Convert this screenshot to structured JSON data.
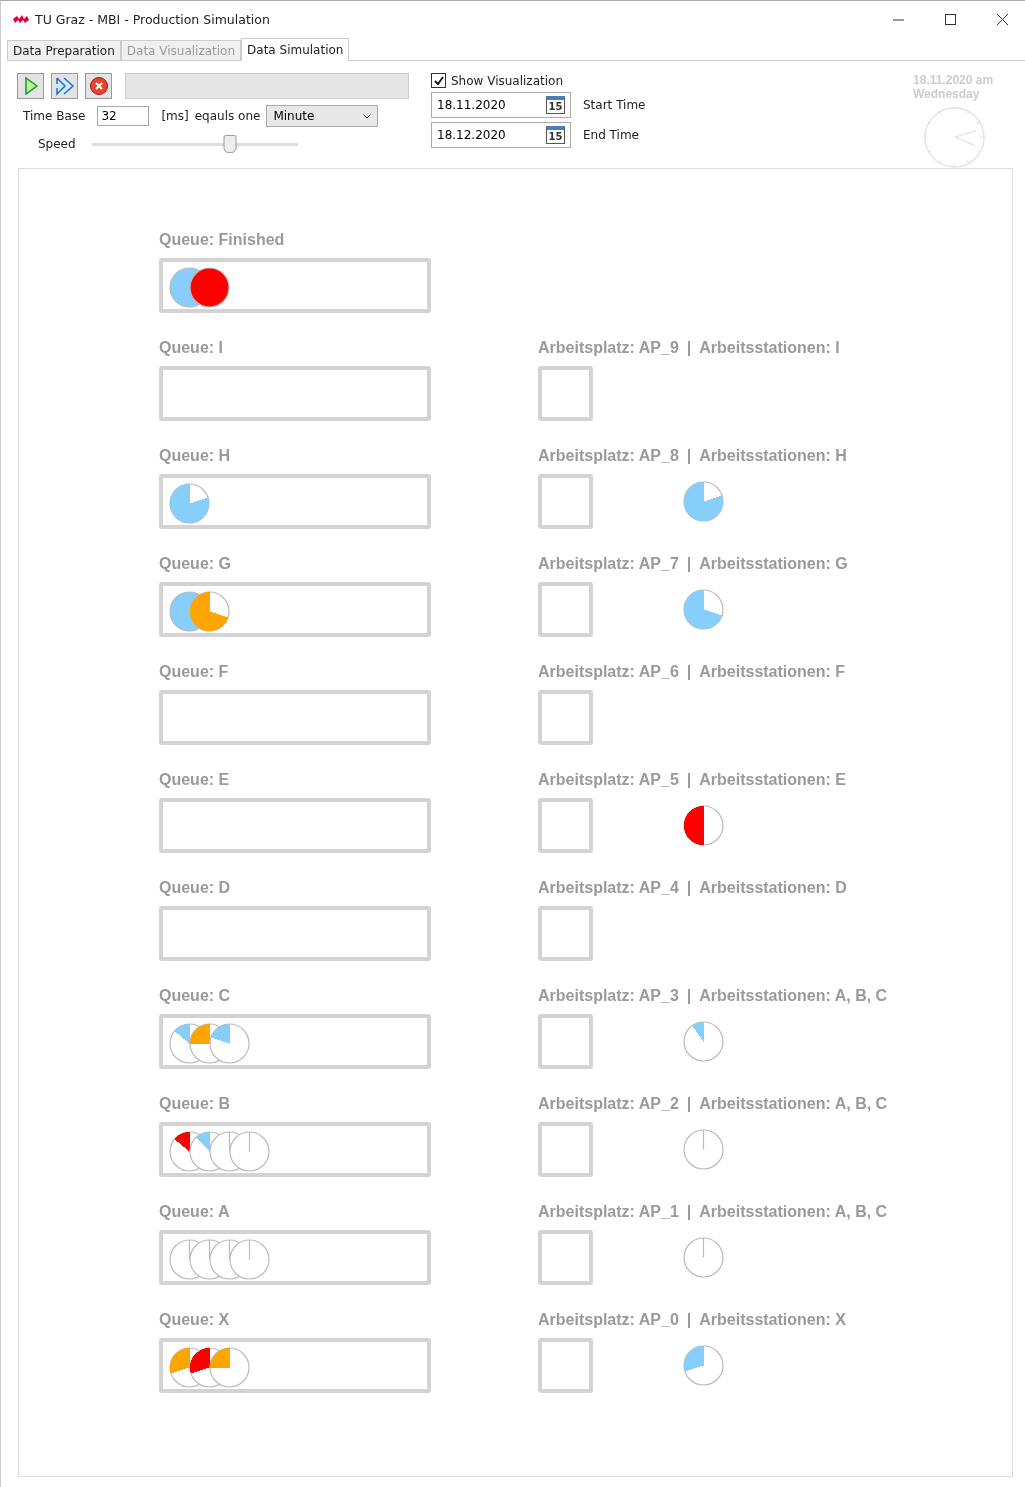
{
  "window": {
    "title": "TU Graz - MBI - Production Simulation"
  },
  "tabs": [
    {
      "label": "Data Preparation",
      "selected": false,
      "disabled": false
    },
    {
      "label": "Data Visualization",
      "selected": false,
      "disabled": true
    },
    {
      "label": "Data Simulation",
      "selected": true,
      "disabled": false
    }
  ],
  "time_base": {
    "label": "Time Base",
    "value": "32",
    "unit": "[ms]",
    "equals": "eqauls one",
    "unit_select": "Minute"
  },
  "speed": {
    "label": "Speed",
    "level": 0.67
  },
  "show_visualization": {
    "label": "Show Visualization",
    "checked": true
  },
  "start_time": {
    "value": "18.11.2020",
    "calendar": "15",
    "label": "Start Time"
  },
  "end_time": {
    "value": "18.12.2020",
    "calendar": "15",
    "label": "End Time"
  },
  "clock": {
    "date": "18.11.2020 am",
    "weekday": "Wednesday"
  },
  "rows": [
    {
      "queue": {
        "label": "Queue: Finished",
        "tokens": [
          {
            "kind": "filled",
            "color": "#87cefa"
          },
          {
            "kind": "filled",
            "color": "#ff0000"
          }
        ]
      }
    },
    {
      "queue": {
        "label": "Queue: I"
      },
      "station": {
        "workplace": "Arbeitsplatz: AP_9",
        "separator": "|",
        "stations": "Arbeitsstationen: I"
      }
    },
    {
      "queue": {
        "label": "Queue: H",
        "tokens": [
          {
            "kind": "filled",
            "color": "#87cefa"
          }
        ]
      },
      "station": {
        "workplace": "Arbeitsplatz: AP_8",
        "separator": "|",
        "stations": "Arbeitsstationen: H",
        "token": {
          "kind": "filled",
          "color": "#87cefa"
        }
      }
    },
    {
      "queue": {
        "label": "Queue: G",
        "tokens": [
          {
            "kind": "filled",
            "color": "#87cefa"
          },
          {
            "kind": "filled",
            "color": "#ffa500"
          }
        ]
      },
      "station": {
        "workplace": "Arbeitsplatz: AP_7",
        "separator": "|",
        "stations": "Arbeitsstationen: G",
        "token": {
          "kind": "filled",
          "color": "#87cefa"
        }
      }
    },
    {
      "queue": {
        "label": "Queue: F"
      },
      "station": {
        "workplace": "Arbeitsplatz: AP_6",
        "separator": "|",
        "stations": "Arbeitsstationen: F"
      }
    },
    {
      "queue": {
        "label": "Queue: E"
      },
      "station": {
        "workplace": "Arbeitsplatz: AP_5",
        "separator": "|",
        "stations": "Arbeitsstationen: E",
        "token": {
          "kind": "filled",
          "color": "#ff0000"
        }
      }
    },
    {
      "queue": {
        "label": "Queue: D"
      },
      "station": {
        "workplace": "Arbeitsplatz: AP_4",
        "separator": "|",
        "stations": "Arbeitsstationen: D"
      }
    },
    {
      "queue": {
        "label": "Queue: C",
        "tokens": [
          {
            "kind": "filled",
            "color": "#87cefa"
          },
          {
            "kind": "filled",
            "color": "#ffa500"
          },
          {
            "kind": "filled",
            "color": "#87cefa"
          }
        ]
      },
      "station": {
        "workplace": "Arbeitsplatz: AP_3",
        "separator": "|",
        "stations": "Arbeitsstationen: A, B, C",
        "token": {
          "kind": "filled",
          "color": "#87cefa"
        }
      }
    },
    {
      "queue": {
        "label": "Queue: B",
        "tokens": [
          {
            "kind": "filled",
            "color": "#ff0000"
          },
          {
            "kind": "filled",
            "color": "#87cefa"
          },
          {
            "kind": "empty"
          },
          {
            "kind": "empty"
          }
        ]
      },
      "station": {
        "workplace": "Arbeitsplatz: AP_2",
        "separator": "|",
        "stations": "Arbeitsstationen: A, B, C",
        "token": {
          "kind": "empty"
        }
      }
    },
    {
      "queue": {
        "label": "Queue: A",
        "tokens": [
          {
            "kind": "empty"
          },
          {
            "kind": "empty"
          },
          {
            "kind": "empty"
          },
          {
            "kind": "empty"
          }
        ]
      },
      "station": {
        "workplace": "Arbeitsplatz: AP_1",
        "separator": "|",
        "stations": "Arbeitsstationen: A, B, C",
        "token": {
          "kind": "empty"
        }
      }
    },
    {
      "queue": {
        "label": "Queue: X",
        "tokens": [
          {
            "kind": "filled",
            "color": "#ffa500"
          },
          {
            "kind": "filled",
            "color": "#ff0000"
          },
          {
            "kind": "filled",
            "color": "#ffa500"
          }
        ]
      },
      "station": {
        "workplace": "Arbeitsplatz: AP_0",
        "separator": "|",
        "stations": "Arbeitsstationen: X",
        "token": {
          "kind": "filled",
          "color": "#87cefa"
        }
      }
    }
  ]
}
